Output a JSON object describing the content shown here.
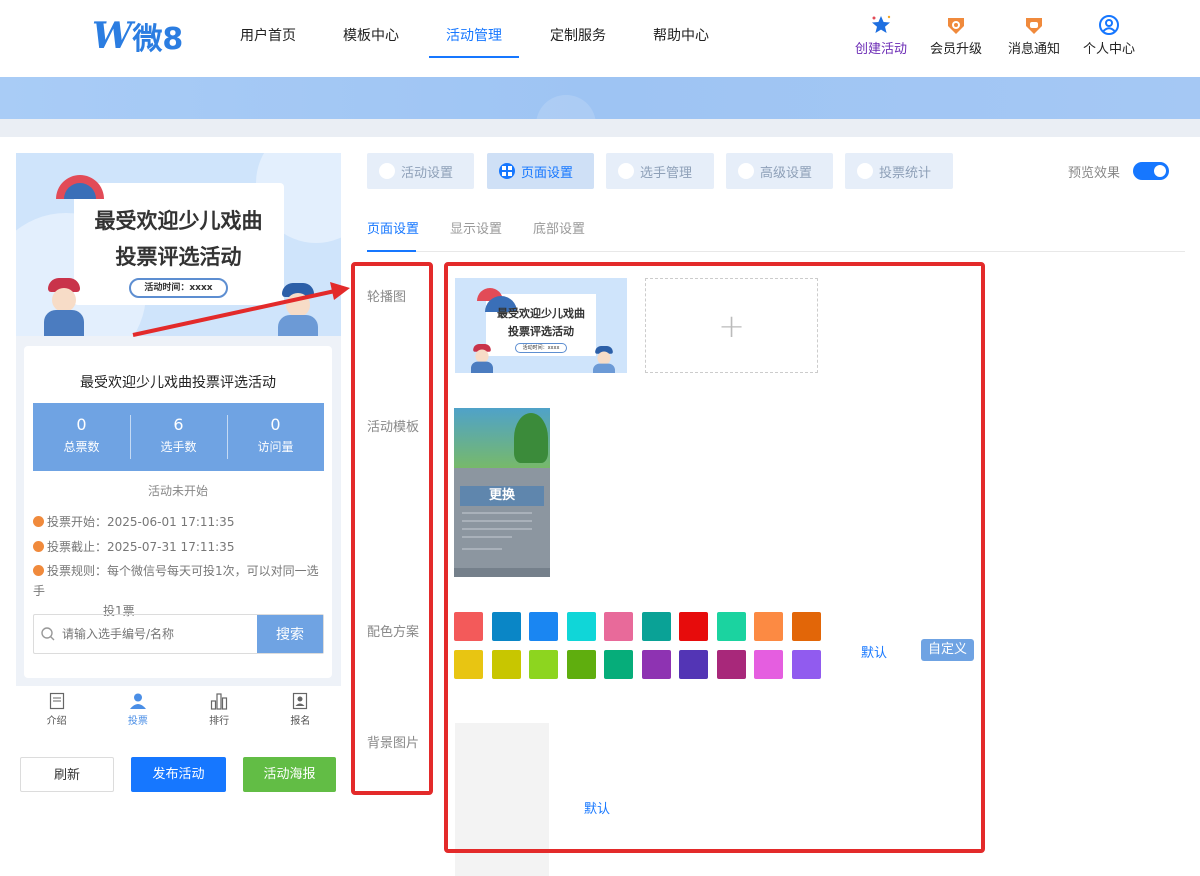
{
  "logo": {
    "w": "W",
    "text": "微8"
  },
  "nav": {
    "items": [
      "用户首页",
      "模板中心",
      "活动管理",
      "定制服务",
      "帮助中心"
    ],
    "right": [
      "创建活动",
      "会员升级",
      "消息通知",
      "个人中心"
    ]
  },
  "preview": {
    "poster_title_1": "最受欢迎少儿戏曲",
    "poster_title_2": "投票评选活动",
    "poster_time": "活动时间：xxxx",
    "title": "最受欢迎少儿戏曲投票评选活动",
    "stats": [
      {
        "num": "0",
        "label": "总票数"
      },
      {
        "num": "6",
        "label": "选手数"
      },
      {
        "num": "0",
        "label": "访问量"
      }
    ],
    "status": "活动未开始",
    "start": "投票开始：2025-06-01 17:11:35",
    "end": "投票截止：2025-07-31 17:11:35",
    "rule_1": "投票规则：每个微信号每天可投1次，可以对同一选手",
    "rule_2": "投1票",
    "search_placeholder": "请输入选手编号/名称",
    "search_btn": "搜索",
    "tabs": [
      "介绍",
      "投票",
      "排行",
      "报名"
    ]
  },
  "actions": {
    "refresh": "刷新",
    "publish": "发布活动",
    "poster": "活动海报"
  },
  "main_tabs": [
    "活动设置",
    "页面设置",
    "选手管理",
    "高级设置",
    "投票统计"
  ],
  "preview_toggle": {
    "label": "预览效果",
    "on": true
  },
  "sub_tabs": [
    "页面设置",
    "显示设置",
    "底部设置"
  ],
  "rows": {
    "carousel": "轮播图",
    "template": "活动模板",
    "color": "配色方案",
    "bg": "背景图片"
  },
  "thumb": {
    "t1": "最受欢迎少儿戏曲",
    "t2": "投票评选活动",
    "time": "活动时间：xxxx"
  },
  "template_change": "更换",
  "colors": [
    "#f35a5a",
    "#0a86c6",
    "#1a86f2",
    "#10d6d8",
    "#e86a9a",
    "#0aa296",
    "#e70c0c",
    "#1bd3a0",
    "#fc8a43",
    "#e26608",
    "#e8c512",
    "#c8c600",
    "#8dd51f",
    "#5fae0e",
    "#06ad7a",
    "#8e33b2",
    "#5335b5",
    "#a8287a",
    "#e55ee0",
    "#915bef"
  ],
  "color_default": "默认",
  "color_custom": "自定义",
  "bg_default": "默认"
}
